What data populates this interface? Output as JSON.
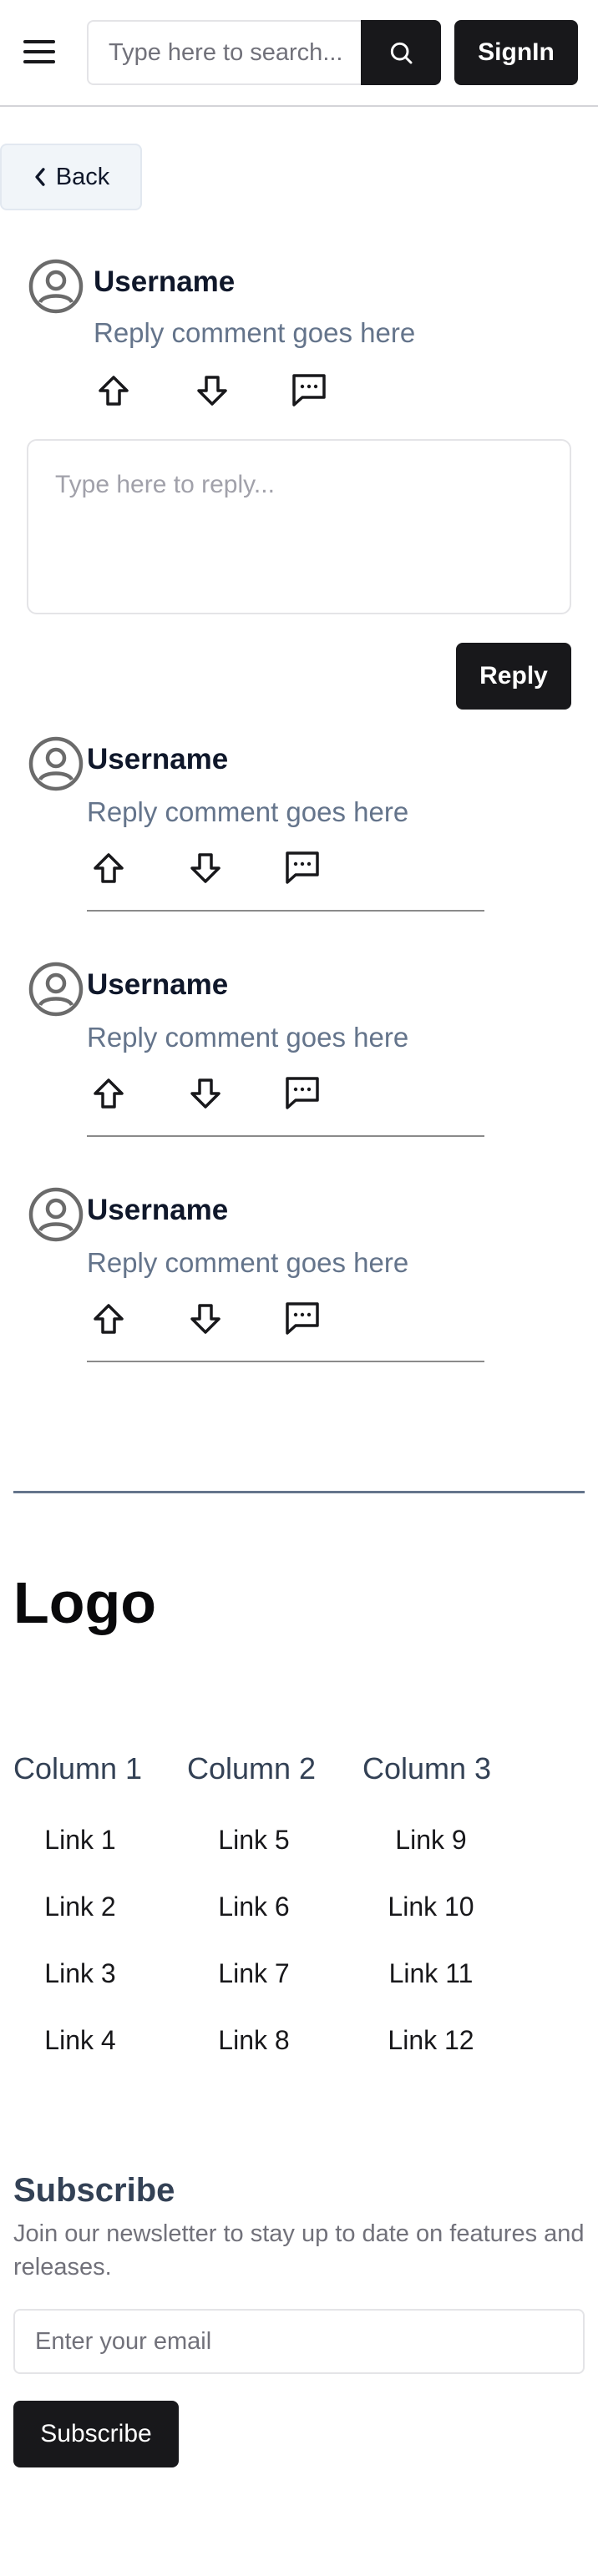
{
  "header": {
    "menu_icon": "hamburger-menu-icon",
    "search": {
      "placeholder": "Type here to search...",
      "value": ""
    },
    "search_icon": "search-icon",
    "signin_label": "SignIn"
  },
  "back": {
    "label": "Back",
    "icon": "chevron-left-icon"
  },
  "main_comment": {
    "username": "Username",
    "text": "Reply comment goes here",
    "icons": [
      "user-avatar-icon",
      "upvote-arrow-icon",
      "downvote-arrow-icon",
      "comment-icon"
    ]
  },
  "reply_form": {
    "placeholder": "Type here to reply...",
    "value": "",
    "button_label": "Reply"
  },
  "replies": [
    {
      "username": "Username",
      "text": "Reply comment goes here"
    },
    {
      "username": "Username",
      "text": "Reply comment goes here"
    },
    {
      "username": "Username",
      "text": "Reply comment goes here"
    }
  ],
  "footer": {
    "logo": "Logo",
    "columns": [
      {
        "title": "Column 1",
        "links": [
          "Link 1",
          "Link 2",
          "Link 3",
          "Link 4"
        ]
      },
      {
        "title": "Column 2",
        "links": [
          "Link 5",
          "Link 6",
          "Link 7",
          "Link 8"
        ]
      },
      {
        "title": "Column 3",
        "links": [
          "Link 9",
          "Link 10",
          "Link 11",
          "Link 12"
        ]
      }
    ],
    "subscribe": {
      "title": "Subscribe",
      "description": "Join our newsletter to stay up to date on features and releases.",
      "email_placeholder": "Enter your email",
      "email_value": "",
      "button_label": "Subscribe"
    }
  },
  "colors": {
    "primary_button": "#18181b",
    "muted_text": "#64748b",
    "back_bg": "#f1f5f9"
  }
}
